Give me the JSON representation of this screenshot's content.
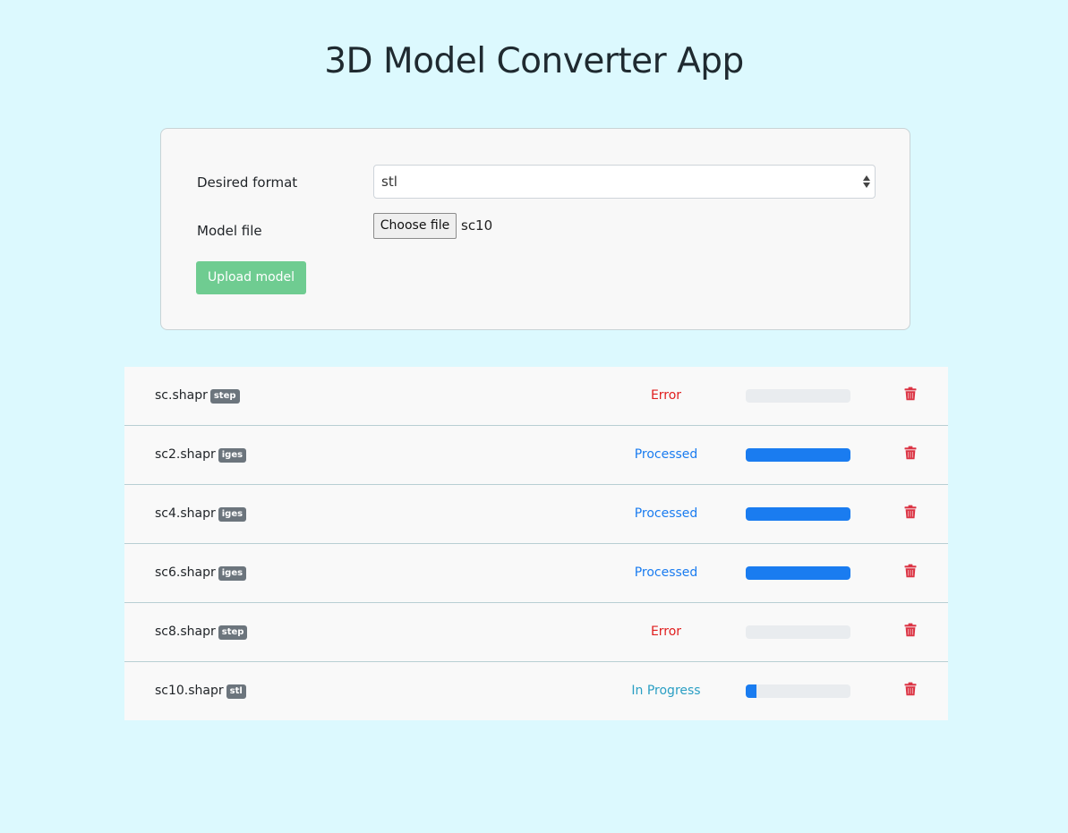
{
  "header": {
    "title": "3D Model Converter App"
  },
  "form": {
    "format_label": "Desired format",
    "format_value": "stl",
    "file_label": "Model file",
    "file_button": "Choose file",
    "file_name": "sc10",
    "upload_button": "Upload model"
  },
  "jobs": [
    {
      "name": "sc.shapr",
      "format": "step",
      "status": "Error",
      "status_color": "#e01e1e",
      "progress": 0
    },
    {
      "name": "sc2.shapr",
      "format": "iges",
      "status": "Processed",
      "status_color": "#1a7cf0",
      "progress": 100
    },
    {
      "name": "sc4.shapr",
      "format": "iges",
      "status": "Processed",
      "status_color": "#1a7cf0",
      "progress": 100
    },
    {
      "name": "sc6.shapr",
      "format": "iges",
      "status": "Processed",
      "status_color": "#1a7cf0",
      "progress": 100
    },
    {
      "name": "sc8.shapr",
      "format": "step",
      "status": "Error",
      "status_color": "#e01e1e",
      "progress": 0
    },
    {
      "name": "sc10.shapr",
      "format": "stl",
      "status": "In Progress",
      "status_color": "#2b9fc4",
      "progress": 10
    }
  ],
  "icons": {
    "delete": "trash-icon",
    "select_arrows": "updown-arrows-icon"
  },
  "colors": {
    "background": "#dcf9fe",
    "upload_button": "#6fcc91",
    "progress_fill": "#1a7cf0",
    "trash": "#dc3545"
  }
}
